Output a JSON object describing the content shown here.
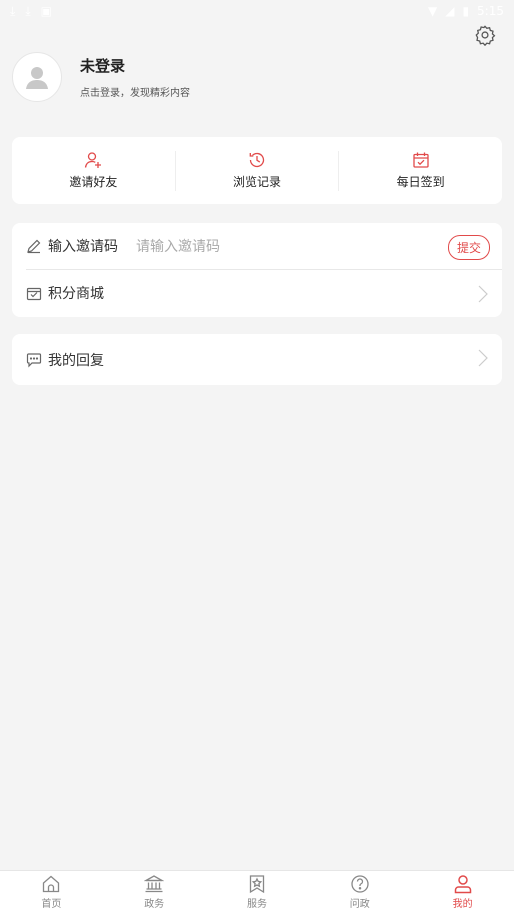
{
  "statusbar": {
    "time": "5:15"
  },
  "profile": {
    "name": "未登录",
    "hint": "点击登录，发现精彩内容"
  },
  "quick_actions": [
    {
      "label": "邀请好友",
      "icon": "add-user-icon"
    },
    {
      "label": "浏览记录",
      "icon": "history-clock-icon"
    },
    {
      "label": "每日签到",
      "icon": "calendar-check-icon"
    }
  ],
  "invite": {
    "label": "输入邀请码",
    "placeholder": "请输入邀请码",
    "submit": "提交"
  },
  "points_mall": {
    "label": "积分商城"
  },
  "my_replies": {
    "label": "我的回复"
  },
  "tabs": [
    {
      "label": "首页",
      "icon": "home-icon"
    },
    {
      "label": "政务",
      "icon": "government-building-icon"
    },
    {
      "label": "服务",
      "icon": "bookmark-star-icon"
    },
    {
      "label": "问政",
      "icon": "question-circle-icon"
    },
    {
      "label": "我的",
      "icon": "user-icon",
      "active": true
    }
  ],
  "colors": {
    "accent": "#e14a4a",
    "background": "#f4f4f4",
    "card": "#ffffff"
  }
}
